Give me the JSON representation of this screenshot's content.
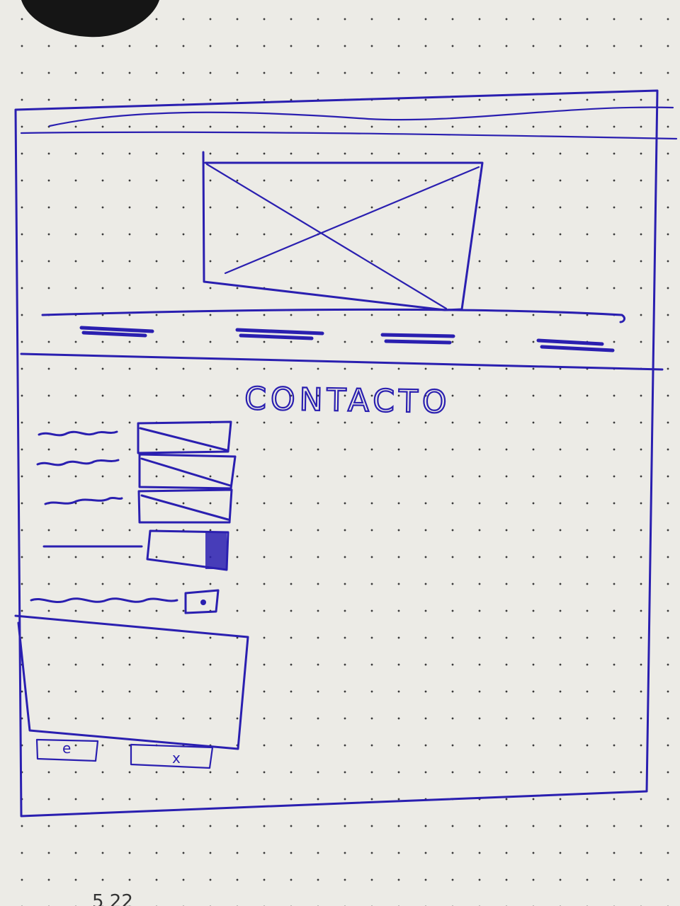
{
  "page": {
    "title": "CONTACTO",
    "submit_button_label": "e",
    "cancel_button_label": "x",
    "page_number_fragment": "5 22"
  },
  "colors": {
    "paper": "#ecebe6",
    "ink": "#2a1fb0",
    "dots": "#3a3a3a"
  }
}
